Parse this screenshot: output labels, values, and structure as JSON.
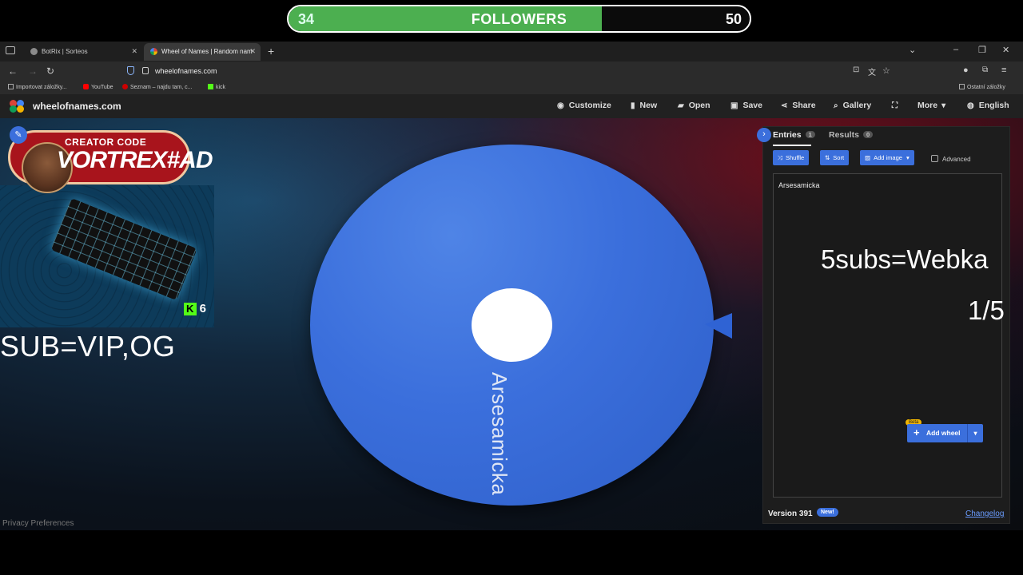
{
  "goal": {
    "current": "34",
    "target": "50",
    "label": "FOLLOWERS",
    "progress_fraction": 0.68
  },
  "browser": {
    "tabs": [
      {
        "title": "BotRix | Sorteos"
      },
      {
        "title": "Wheel of Names | Random nam"
      }
    ],
    "url": "wheelofnames.com",
    "bookmarks": [
      "Importovat záložky...",
      "YouTube",
      "Seznam – najdu tam, c...",
      "kick"
    ],
    "other_bookmarks": "Ostatní záložky"
  },
  "site": {
    "name": "wheelofnames.com",
    "menu": [
      "Customize",
      "New",
      "Open",
      "Save",
      "Share",
      "Gallery",
      "More",
      "English"
    ]
  },
  "wheel": {
    "entry_label": "Arsesamicka",
    "colors": {
      "wheel": "#3b6fdc",
      "hub": "#ffffff"
    }
  },
  "overlay": {
    "creator_code_title": "CREATOR CODE",
    "creator_code": "VORTREX#AD",
    "kick_viewers": "6",
    "sub_text": "SUB=VIP,OG",
    "subs_goal": "5subs=Webka",
    "subs_progress": "1/5"
  },
  "panel": {
    "tabs": [
      {
        "label": "Entries",
        "count": "1"
      },
      {
        "label": "Results",
        "count": "0"
      }
    ],
    "buttons": {
      "shuffle": "Shuffle",
      "sort": "Sort",
      "add_image": "Add image"
    },
    "advanced": "Advanced",
    "entries": [
      "Arsesamicka"
    ],
    "beta": "Beta",
    "add_wheel": "Add wheel",
    "version": "Version 391",
    "new_badge": "New!",
    "changelog": "Changelog"
  },
  "footer": {
    "privacy": "Privacy Preferences"
  }
}
